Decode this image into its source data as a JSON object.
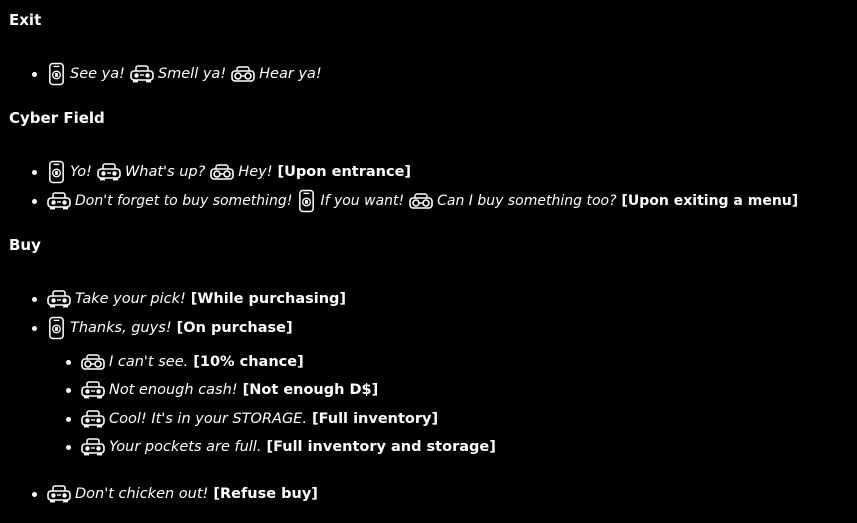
{
  "sections": {
    "exit": {
      "title": "Exit",
      "line1": {
        "i1": "tall-robot-icon",
        "t1": "See ya!",
        "i2": "car-robot-icon",
        "t2": "Smell ya!",
        "i3": "goggles-robot-icon",
        "t3": "Hear ya!"
      }
    },
    "cyber": {
      "title": "Cyber Field",
      "line1": {
        "i1": "tall-robot-icon",
        "t1": "Yo!",
        "i2": "car-robot-icon",
        "t2": "What's up?",
        "i3": "goggles-robot-icon",
        "t3": "Hey!",
        "tag": "[Upon entrance]"
      },
      "line2": {
        "i1": "car-robot-icon",
        "t1": "Don't forget to buy something!",
        "i2": "tall-robot-icon",
        "t2": "If you want!",
        "i3": "goggles-robot-icon",
        "t3": "Can I buy something too?",
        "tag": "[Upon exiting a menu]"
      }
    },
    "buy": {
      "title": "Buy",
      "line1": {
        "i1": "car-robot-icon",
        "t1": "Take your pick!",
        "tag": "[While purchasing]"
      },
      "line2": {
        "i1": "tall-robot-icon",
        "t1": "Thanks, guys!",
        "tag": "[On purchase]"
      },
      "sub1": {
        "i1": "goggles-robot-icon",
        "t1": "I can't see.",
        "tag": "[10% chance]"
      },
      "sub2": {
        "i1": "car-robot-icon",
        "t1": "Not enough cash!",
        "tag": "[Not enough D$]"
      },
      "sub3": {
        "i1": "car-robot-icon",
        "t1": "Cool! It's in your STORAGE.",
        "tag": "[Full inventory]"
      },
      "sub4": {
        "i1": "car-robot-icon",
        "t1": "Your pockets are full.",
        "tag": "[Full inventory and storage]"
      },
      "line3": {
        "i1": "car-robot-icon",
        "t1": "Don't chicken out!",
        "tag": "[Refuse buy]"
      }
    }
  }
}
